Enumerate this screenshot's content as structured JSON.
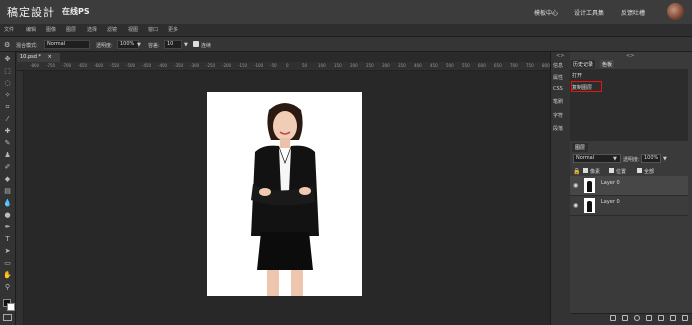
{
  "header": {
    "logo": "稿定設計",
    "subtitle": "在线PS",
    "links": [
      "模板中心",
      "设计工具集",
      "反馈吐槽"
    ]
  },
  "menu": [
    "文件",
    "编辑",
    "图像",
    "图层",
    "选择",
    "滤镜",
    "视图",
    "窗口",
    "更多"
  ],
  "options": {
    "blend_label": "混合模式:",
    "blend_value": "Normal",
    "opacity_label": "透明度:",
    "opacity_value": "100%",
    "tolerance_label": "容差:",
    "tolerance_value": "10",
    "continuous_label": "连续"
  },
  "document": {
    "tab_label": "10.psd *",
    "close_glyph": "×"
  },
  "ruler_ticks": [
    "-800",
    "-750",
    "-700",
    "-650",
    "-600",
    "-550",
    "-500",
    "-450",
    "-400",
    "-350",
    "-300",
    "-250",
    "-200",
    "-150",
    "-100",
    "-50",
    "0",
    "50",
    "100",
    "150",
    "200",
    "250",
    "300",
    "350",
    "400",
    "450",
    "500",
    "550",
    "600",
    "650",
    "700",
    "750",
    "800"
  ],
  "side_buttons": [
    "信息",
    "属性",
    "CSS",
    "笔刷",
    "字符",
    "段落"
  ],
  "panels": {
    "history_tab": "历史记录",
    "swatch_tab": "色板",
    "history_items": [
      "打开",
      "复制图层"
    ],
    "layers_tab": "图层",
    "blend_value": "Normal",
    "opacity_label": "透明度:",
    "opacity_value": "100%",
    "lock_label": "锁定:",
    "lock_options": [
      "像素",
      "位置",
      "全部"
    ],
    "layers": [
      {
        "name": "Layer 0"
      },
      {
        "name": "Layer 0"
      }
    ]
  },
  "colors": {
    "accent_border": "#e11111",
    "canvas_bg": "#282828",
    "panel_bg": "#3a3a3a"
  }
}
